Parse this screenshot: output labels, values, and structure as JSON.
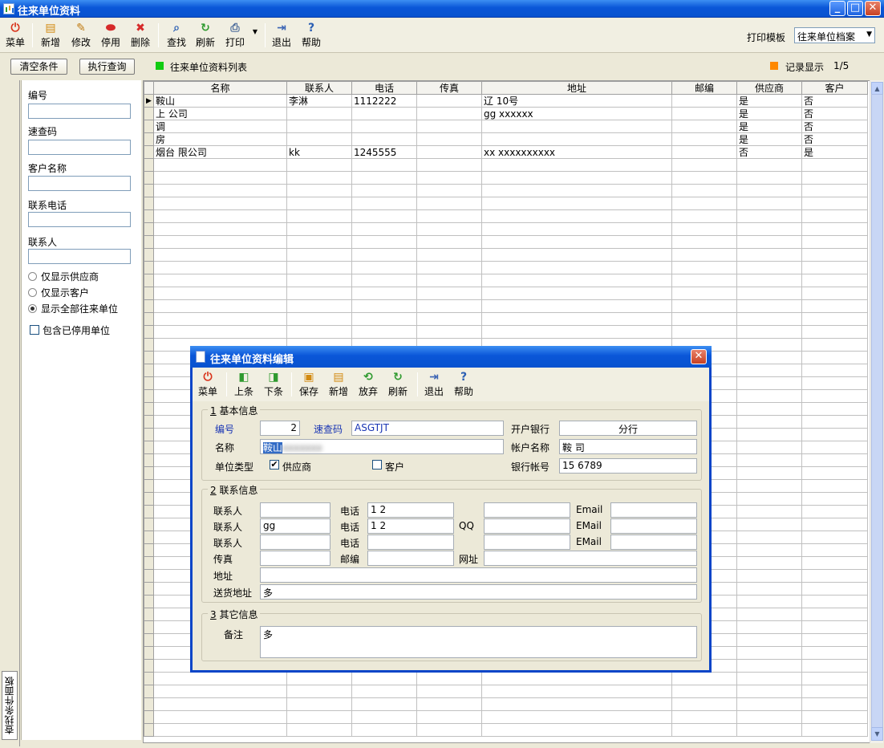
{
  "window": {
    "title": "往来单位资料"
  },
  "toolbar": {
    "buttons": [
      {
        "label": "菜单",
        "icon": "power-icon",
        "color": "#d9341c"
      },
      {
        "label": "新增",
        "icon": "new-doc-icon",
        "color": "#d28a12"
      },
      {
        "label": "修改",
        "icon": "edit-icon",
        "color": "#c07a10"
      },
      {
        "label": "停用",
        "icon": "stop-icon",
        "color": "#d62a2a"
      },
      {
        "label": "删除",
        "icon": "delete-icon",
        "color": "#d62a2a"
      },
      {
        "label": "查找",
        "icon": "search-icon",
        "color": "#2b5fb3"
      },
      {
        "label": "刷新",
        "icon": "refresh-icon",
        "color": "#2f9a2f"
      },
      {
        "label": "打印",
        "icon": "print-icon",
        "color": "#4a6a9a"
      },
      {
        "label": "退出",
        "icon": "exit-icon",
        "color": "#3b64b4"
      },
      {
        "label": "帮助",
        "icon": "help-icon",
        "color": "#2b5fb3"
      }
    ],
    "print_template_label": "打印模板",
    "print_template_value": "往来单位档案"
  },
  "query": {
    "clear_label": "清空条件",
    "execute_label": "执行查询",
    "list_title": "往来单位资料列表",
    "record_label": "记录显示",
    "record_value": "1/5",
    "list_color": "#11cc11",
    "record_color": "#ff8800"
  },
  "filter": {
    "fields": [
      "编号",
      "速查码",
      "客户名称",
      "联系电话",
      "联系人"
    ],
    "radios": [
      {
        "label": "仅显示供应商",
        "checked": false
      },
      {
        "label": "仅显示客户",
        "checked": false
      },
      {
        "label": "显示全部往来单位",
        "checked": true
      }
    ],
    "include_disabled": "包含已停用单位",
    "side_tab": "查找条件面板"
  },
  "grid": {
    "columns": [
      "名称",
      "联系人",
      "电话",
      "传真",
      "地址",
      "邮编",
      "供应商",
      "客户"
    ],
    "rows": [
      [
        "鞍山",
        "李淋",
        "1112222",
        "",
        "辽 10号",
        "",
        "是",
        "否"
      ],
      [
        "上 公司",
        "",
        "",
        "",
        "gg xxxxxx",
        "",
        "是",
        "否"
      ],
      [
        "调",
        "",
        "",
        "",
        "",
        "",
        "是",
        "否"
      ],
      [
        "房 ",
        "",
        "",
        "",
        "",
        "",
        "是",
        "否"
      ],
      [
        "烟台 限公司",
        "kk",
        "1245555",
        "",
        "xx xxxxxxxxxx",
        "",
        "否",
        "是"
      ]
    ]
  },
  "dialog": {
    "title": "往来单位资料编辑",
    "toolbar": [
      {
        "label": "菜单",
        "icon": "power-icon",
        "color": "#d9341c"
      },
      {
        "label": "上条",
        "icon": "prev-icon",
        "color": "#2f9a2f"
      },
      {
        "label": "下条",
        "icon": "next-icon",
        "color": "#2f9a2f"
      },
      {
        "label": "保存",
        "icon": "save-icon",
        "color": "#d28a12"
      },
      {
        "label": "新增",
        "icon": "new-doc-icon",
        "color": "#d28a12"
      },
      {
        "label": "放弃",
        "icon": "undo-icon",
        "color": "#2f9a2f"
      },
      {
        "label": "刷新",
        "icon": "refresh-icon",
        "color": "#2f9a2f"
      },
      {
        "label": "退出",
        "icon": "exit-icon",
        "color": "#3b64b4"
      },
      {
        "label": "帮助",
        "icon": "help-icon",
        "color": "#2b5fb3"
      }
    ],
    "basic": {
      "legend_num": "1",
      "legend_text": "基本信息",
      "code_label": "编号",
      "code_value": "2",
      "quick_label": "速查码",
      "quick_value": "ASGTJT",
      "name_label": "名称",
      "name_value": "鞍山",
      "type_label": "单位类型",
      "supplier_label": "供应商",
      "supplier_checked": true,
      "customer_label": "客户",
      "customer_checked": false,
      "bank_label": "开户银行",
      "bank_value": "分行",
      "account_name_label": "帐户名称",
      "account_name_value": "鞍 司",
      "account_no_label": "银行帐号",
      "account_no_value": "15 6789"
    },
    "contact": {
      "legend_num": "2",
      "legend_text": "联系信息",
      "rows": [
        {
          "person_label": "联系人",
          "person": "",
          "phone_label": "电话",
          "phone": "1 2",
          "email_label": "Email",
          "email": ""
        },
        {
          "person_label": "联系人",
          "person": "gg",
          "phone_label": "电话",
          "phone": "1 2",
          "mid_label": "QQ",
          "email_label": "EMail",
          "email": ""
        },
        {
          "person_label": "联系人",
          "person": "",
          "phone_label": "电话",
          "phone": "",
          "email_label": "EMail",
          "email": ""
        }
      ],
      "fax_label": "传真",
      "post_label": "邮编",
      "web_label": "网址",
      "addr_label": "地址",
      "addr_value": "",
      "ship_label": "送货地址",
      "ship_value": "多"
    },
    "other": {
      "legend_num": "3",
      "legend_text": "其它信息",
      "remark_label": "备注",
      "remark_value": "多"
    }
  }
}
